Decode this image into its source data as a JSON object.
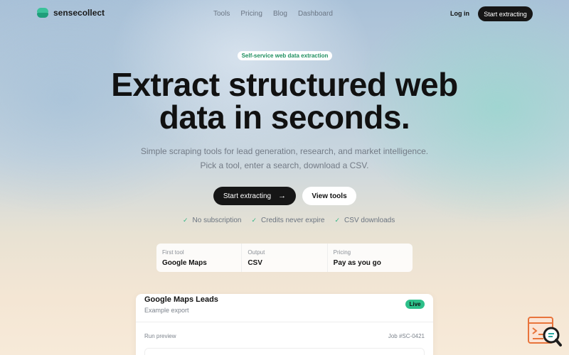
{
  "nav": {
    "brand": "sensecollect",
    "links": [
      "Tools",
      "Pricing",
      "Blog",
      "Dashboard"
    ],
    "login": "Log in",
    "cta": "Start extracting"
  },
  "hero": {
    "tag": "Self-service web data extraction",
    "headline_line1": "Extract structured web",
    "headline_line2": "data in seconds.",
    "subtext": "Simple scraping tools for lead generation, research, and market intelligence. Pick a tool, enter a search, download a CSV.",
    "primary_button": "Start extracting",
    "secondary_button": "View tools",
    "features": [
      "No subscription",
      "Credits never expire",
      "CSV downloads"
    ]
  },
  "stats": [
    {
      "label": "First tool",
      "value": "Google Maps"
    },
    {
      "label": "Output",
      "value": "CSV"
    },
    {
      "label": "Pricing",
      "value": "Pay as you go"
    }
  ],
  "card": {
    "title": "Google Maps Leads",
    "subtitle": "Example export",
    "badge": "Live",
    "run_label": "Run preview",
    "job_id": "Job #SC-0421"
  },
  "colors": {
    "accent": "#34b585",
    "dark_button": "#161616",
    "widget_orange": "#e8743b"
  },
  "icons": {
    "logo": "stacked-disc-logo-icon",
    "arrow": "arrow-right-icon",
    "check": "check-icon",
    "widget": "search-chat-icon"
  }
}
